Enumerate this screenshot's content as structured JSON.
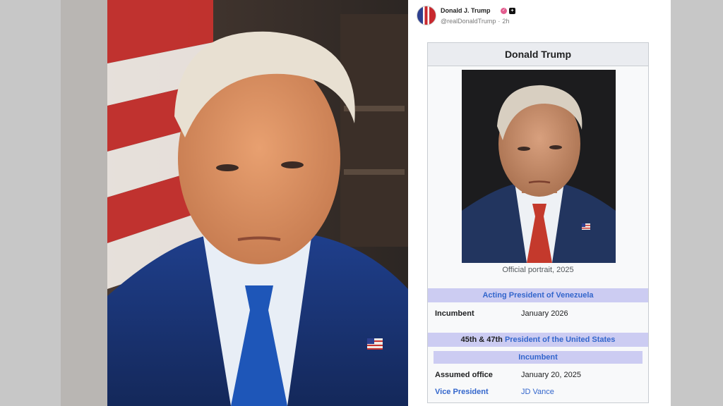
{
  "post": {
    "author_name": "Donald J. Trump",
    "author_handle": "@realDonaldTrump",
    "time": "2h"
  },
  "infobox": {
    "title": "Donald Trump",
    "caption": "Official portrait, 2025",
    "office1": {
      "header": "Acting President of Venezuela",
      "status_label": "Incumbent",
      "status_value": "January 2026"
    },
    "office2": {
      "header_prefix": "45th & 47th",
      "header_link": "President of the United States",
      "sub": "Incumbent",
      "assumed_label": "Assumed office",
      "assumed_value": "January 20, 2025",
      "vp_label": "Vice President",
      "vp_value": "JD Vance"
    }
  },
  "colors": {
    "link": "#3366cc",
    "section_bg": "#ccccf2",
    "infobox_bg": "#f8f9fa"
  }
}
